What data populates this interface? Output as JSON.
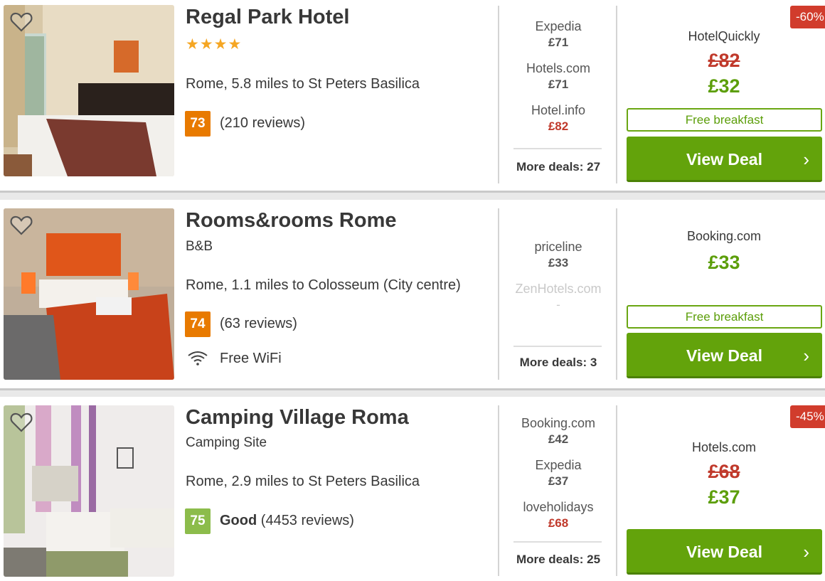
{
  "hotels": [
    {
      "name": "Regal Park Hotel",
      "stars": "★★★★",
      "type": "",
      "location": "Rome, 5.8 miles to St Peters Basilica",
      "rating": "73",
      "rating_word": "",
      "reviews": "(210 reviews)",
      "amenity": "",
      "deals": [
        {
          "provider": "Expedia",
          "price": "£71"
        },
        {
          "provider": "Hotels.com",
          "price": "£71"
        },
        {
          "provider": "Hotel.info",
          "price": "£82"
        }
      ],
      "more_deals": "More deals: 27",
      "best": {
        "provider": "HotelQuickly",
        "old_price": "£82",
        "price": "£32",
        "perk": "Free breakfast",
        "cta": "View Deal",
        "discount": "-60%"
      }
    },
    {
      "name": "Rooms&rooms Rome",
      "type": "B&B",
      "location": "Rome, 1.1 miles to Colosseum (City centre)",
      "rating": "74",
      "reviews": "(63 reviews)",
      "amenity": "Free WiFi",
      "deals": [
        {
          "provider": "priceline",
          "price": "£33"
        },
        {
          "provider": "ZenHotels.com",
          "price": "-"
        }
      ],
      "more_deals": "More deals: 3",
      "best": {
        "provider": "Booking.com",
        "price": "£33",
        "perk": "Free breakfast",
        "cta": "View Deal"
      }
    },
    {
      "name": "Camping Village Roma",
      "type": "Camping Site",
      "location": "Rome, 2.9 miles to St Peters Basilica",
      "rating": "75",
      "rating_word": "Good",
      "reviews": "(4453 reviews)",
      "deals": [
        {
          "provider": "Booking.com",
          "price": "£42"
        },
        {
          "provider": "Expedia",
          "price": "£37"
        },
        {
          "provider": "loveholidays",
          "price": "£68"
        }
      ],
      "more_deals": "More deals: 25",
      "best": {
        "provider": "Hotels.com",
        "old_price": "£68",
        "price": "£37",
        "cta": "View Deal",
        "discount": "-45%"
      }
    }
  ],
  "icons": {
    "favorite": "heart-outline-icon",
    "wifi": "wifi-icon",
    "chevron": "chevron-right-icon"
  },
  "colors": {
    "cta_green": "#63a30b",
    "price_green": "#5c9e0a",
    "price_red": "#c0392b",
    "rating_orange": "#e87a00",
    "rating_green": "#8cbc4b",
    "star_gold": "#f5a623",
    "discount_red": "#d13c2c"
  }
}
